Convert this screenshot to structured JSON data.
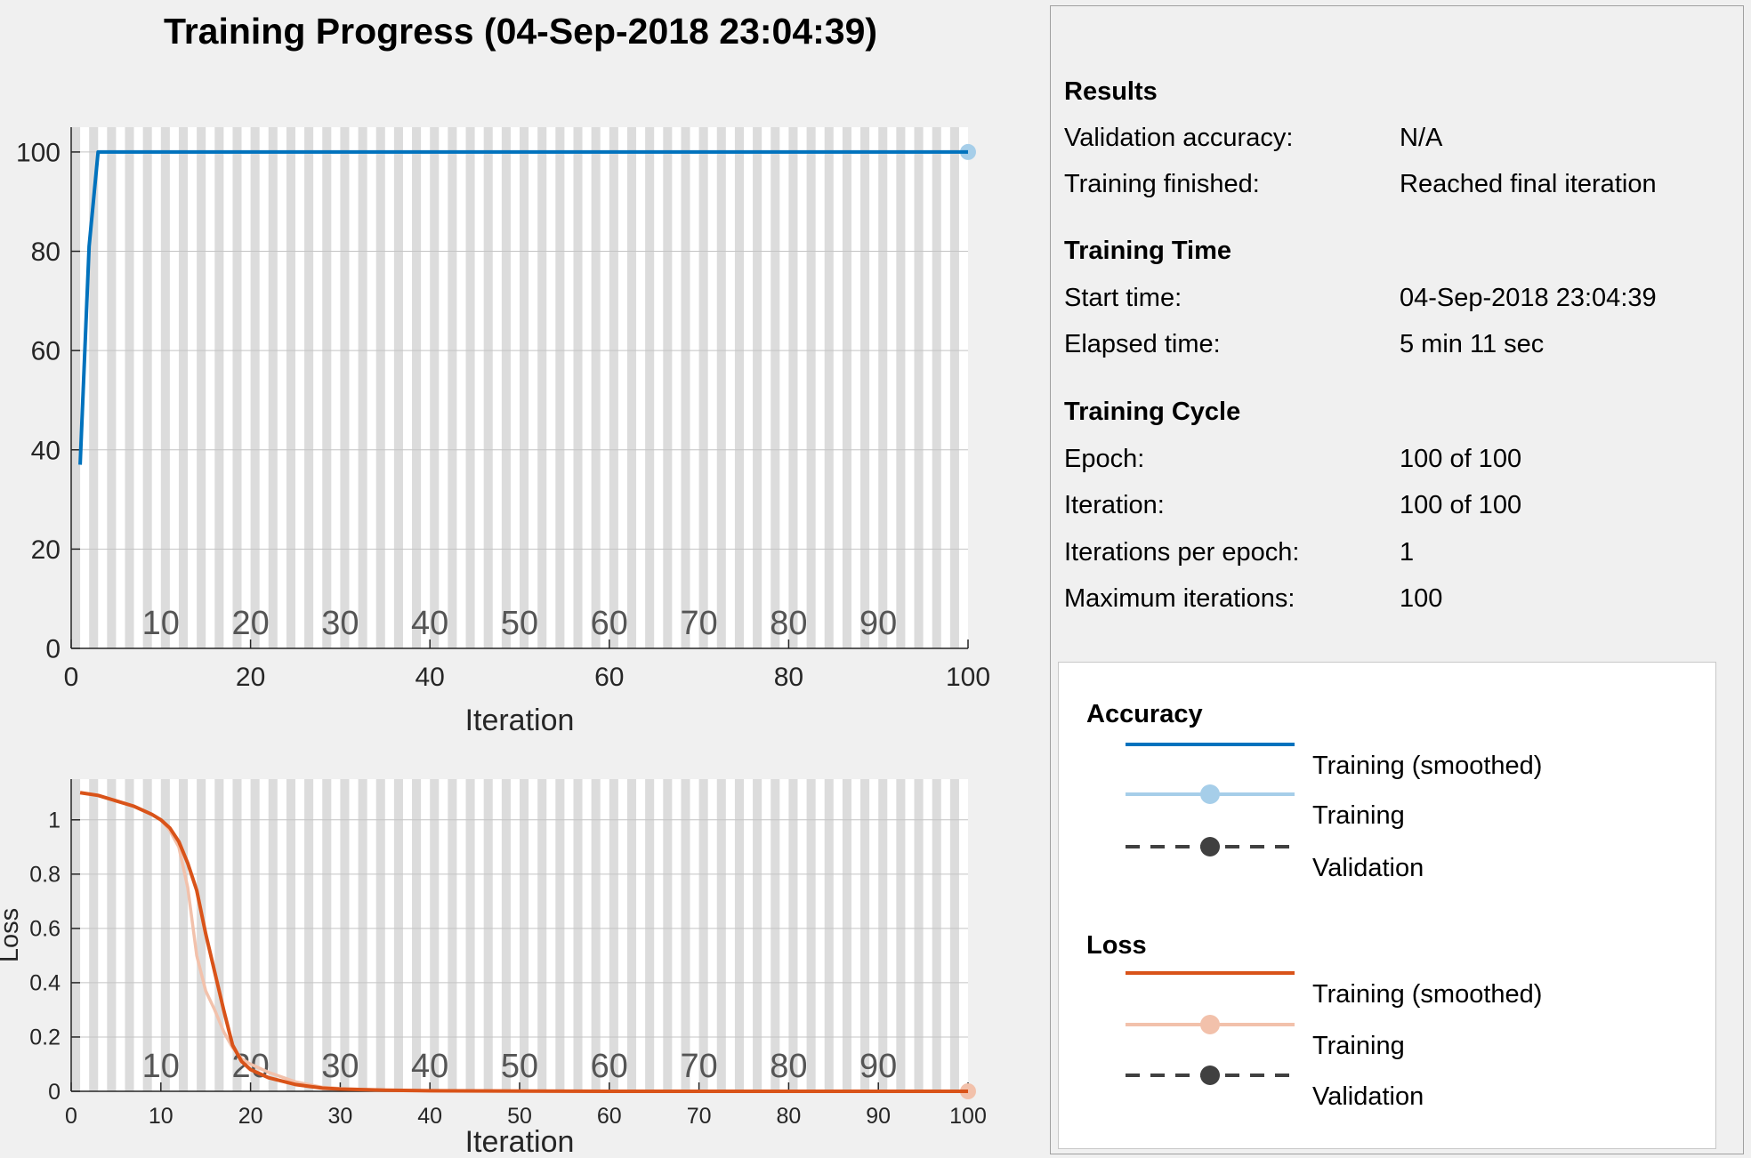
{
  "title": "Training Progress (04-Sep-2018 23:04:39)",
  "info": {
    "results_title": "Results",
    "validation_accuracy_label": "Validation accuracy:",
    "validation_accuracy_value": "N/A",
    "training_finished_label": "Training finished:",
    "training_finished_value": "Reached final iteration",
    "time_title": "Training Time",
    "start_time_label": "Start time:",
    "start_time_value": "04-Sep-2018 23:04:39",
    "elapsed_label": "Elapsed time:",
    "elapsed_value": "5 min 11 sec",
    "cycle_title": "Training Cycle",
    "epoch_label": "Epoch:",
    "epoch_value": "100 of 100",
    "iteration_label": "Iteration:",
    "iteration_value": "100 of 100",
    "ipe_label": "Iterations per epoch:",
    "ipe_value": "1",
    "max_iter_label": "Maximum iterations:",
    "max_iter_value": "100"
  },
  "legend": {
    "accuracy_title": "Accuracy",
    "loss_title": "Loss",
    "smoothed_label": "Training (smoothed)",
    "training_label": "Training",
    "validation_label": "Validation"
  },
  "colors": {
    "accuracy_smoothed": "#0072bd",
    "accuracy_raw": "#a6cee9",
    "loss_smoothed": "#d95319",
    "loss_raw": "#f2c1ab",
    "validation": "#404040",
    "stripe": "#dcdcdc"
  },
  "chart_data": [
    {
      "type": "line",
      "xlabel": "Iteration",
      "ylabel": "",
      "xlim": [
        0,
        100
      ],
      "ylim": [
        0,
        105
      ],
      "xticks": [
        0,
        20,
        40,
        60,
        80,
        100
      ],
      "yticks": [
        0,
        20,
        40,
        60,
        80,
        100
      ],
      "epoch_labels": [
        10,
        20,
        30,
        40,
        50,
        60,
        70,
        80,
        90
      ],
      "grid": true,
      "series": [
        {
          "x": [
            1,
            2,
            3,
            100
          ],
          "values": [
            37,
            81,
            100,
            100
          ]
        },
        {
          "x": [
            1,
            2,
            3,
            100
          ],
          "values": [
            37,
            81,
            100,
            100
          ],
          "final_marker": true
        }
      ]
    },
    {
      "type": "line",
      "xlabel": "Iteration",
      "ylabel": "Loss",
      "xlim": [
        0,
        100
      ],
      "ylim": [
        0,
        1.15
      ],
      "xticks": [
        0,
        10,
        20,
        30,
        40,
        50,
        60,
        70,
        80,
        90,
        100
      ],
      "yticks": [
        0,
        0.2,
        0.4,
        0.6,
        0.8,
        1
      ],
      "epoch_labels": [
        10,
        20,
        30,
        40,
        50,
        60,
        70,
        80,
        90
      ],
      "grid": true,
      "series": [
        {
          "x": [
            1,
            3,
            5,
            7,
            9,
            10,
            11,
            12,
            13,
            14,
            15,
            16,
            17,
            18,
            19,
            20,
            22,
            25,
            28,
            30,
            35,
            40,
            50,
            60,
            70,
            80,
            90,
            100
          ],
          "values": [
            1.1,
            1.09,
            1.07,
            1.05,
            1.02,
            1.0,
            0.97,
            0.92,
            0.84,
            0.74,
            0.58,
            0.44,
            0.3,
            0.17,
            0.11,
            0.08,
            0.05,
            0.025,
            0.012,
            0.008,
            0.004,
            0.002,
            0.001,
            0.0,
            0.0,
            0.0,
            0.0,
            0.0
          ]
        },
        {
          "x": [
            1,
            3,
            5,
            7,
            9,
            10,
            11,
            12,
            13,
            14,
            15,
            16,
            17,
            18,
            19,
            20,
            22,
            25,
            28,
            30,
            35,
            40,
            50,
            60,
            70,
            80,
            90,
            100
          ],
          "values": [
            1.1,
            1.09,
            1.07,
            1.05,
            1.02,
            1.0,
            0.96,
            0.9,
            0.75,
            0.5,
            0.37,
            0.3,
            0.22,
            0.16,
            0.12,
            0.1,
            0.07,
            0.035,
            0.015,
            0.01,
            0.004,
            0.002,
            0.001,
            0.0,
            0.0,
            0.0,
            0.0,
            0.0
          ],
          "final_marker": true
        }
      ]
    }
  ]
}
